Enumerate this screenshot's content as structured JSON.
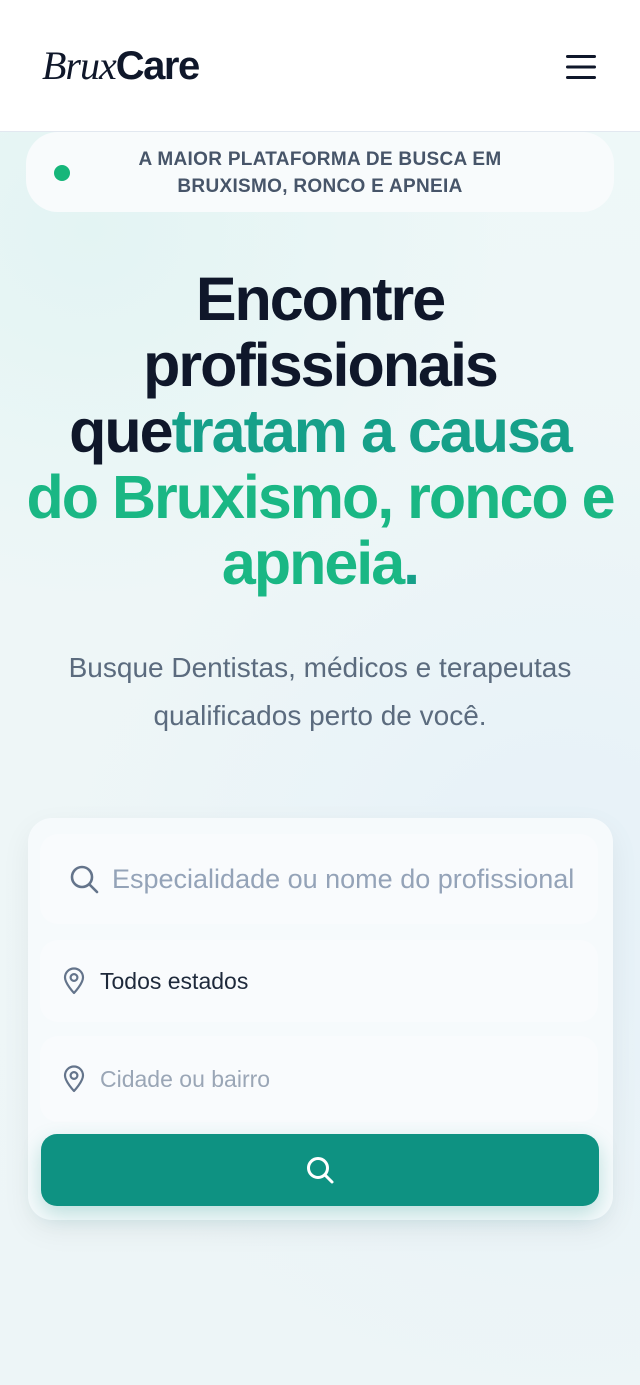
{
  "header": {
    "logo_italic": "Brux",
    "logo_bold": "Care",
    "menu_icon": "hamburger-menu-icon"
  },
  "badge": {
    "line1": "A MAIOR PLATAFORMA DE BUSCA EM",
    "line2": "BRUXISMO, RONCO E APNEIA",
    "dot_color": "#16b67a"
  },
  "hero": {
    "line1": "Encontre",
    "line2": "profissionais",
    "line3_dark": "que",
    "line3_green": "tratam a causa",
    "line4": "do Bruxismo, ronco e",
    "line5_word": "apneia",
    "line5_period": "."
  },
  "subtitle": {
    "line1": "Busque Dentistas, médicos e terapeutas",
    "line2": "qualificados perto de você."
  },
  "search_form": {
    "specialty_placeholder": "Especialidade ou nome do profissional",
    "state_value": "Todos estados",
    "city_placeholder": "Cidade ou bairro",
    "search_button_icon": "search-icon"
  },
  "colors": {
    "accent_green": "#1ab784",
    "accent_teal": "#16a089",
    "button": "#0e9282",
    "text_dark": "#0f172a"
  }
}
